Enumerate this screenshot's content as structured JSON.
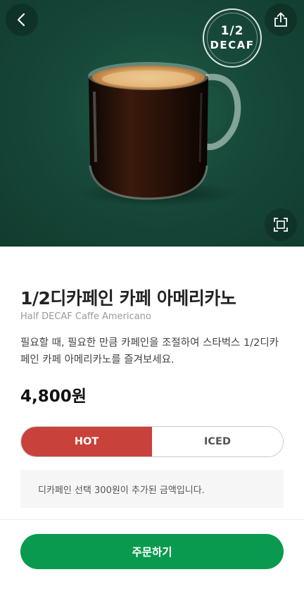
{
  "header": {
    "back_icon": "chevron-left-icon",
    "share_icon": "share-icon",
    "expand_icon": "expand-icon"
  },
  "badge": {
    "top": "1/2",
    "bottom": "DECAF"
  },
  "product": {
    "name": "1/2디카페인 카페 아메리카노",
    "name_en": "Half DECAF Caffe Americano",
    "description": "필요할 때, 필요한 만큼 카페인을 조절하여 스타벅스 1/2디카페인 카페 아메리카노를 즐겨보세요.",
    "price": "4,800원"
  },
  "temperature": {
    "options": [
      "HOT",
      "ICED"
    ],
    "selected": "HOT"
  },
  "notice": "디카페인 선택 300원이 추가된 금액입니다.",
  "order_button": "주문하기",
  "colors": {
    "hero_bg": "#17493a",
    "hot_selected": "#c8413a",
    "order_green": "#0a9a4f"
  }
}
